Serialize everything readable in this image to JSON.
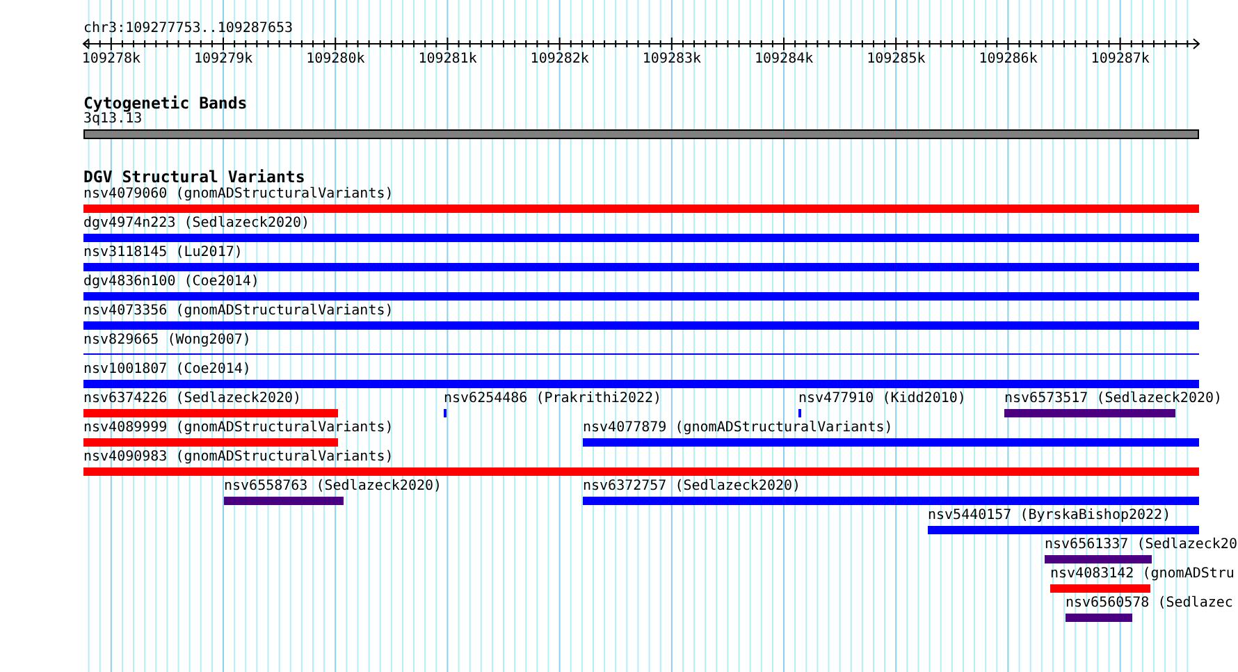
{
  "location": "chr3:109277753..109287653",
  "ruler": {
    "labels": [
      "109278k",
      "109279k",
      "109280k",
      "109281k",
      "109282k",
      "109283k",
      "109284k",
      "109285k",
      "109286k",
      "109287k"
    ]
  },
  "cytogenetic_bands": {
    "title": "Cytogenetic Bands",
    "band": "3q13.13"
  },
  "dgv_track": {
    "title": "DGV Structural Variants",
    "rows": [
      [
        {
          "label": "nsv4079060 (gnomADStructuralVariants)",
          "color": "#ff0000"
        }
      ],
      [
        {
          "label": "dgv4974n223 (Sedlazeck2020)",
          "color": "#0000ff"
        }
      ],
      [
        {
          "label": "nsv3118145 (Lu2017)",
          "color": "#0000ff"
        }
      ],
      [
        {
          "label": "dgv4836n100 (Coe2014)",
          "color": "#0000ff"
        }
      ],
      [
        {
          "label": "nsv4073356 (gnomADStructuralVariants)",
          "color": "#0000ff"
        }
      ],
      [
        {
          "label": "nsv829665 (Wong2007)",
          "color": "#0000ff"
        }
      ],
      [
        {
          "label": "nsv1001807 (Coe2014)",
          "color": "#0000ff"
        }
      ],
      [
        {
          "label": "nsv6374226 (Sedlazeck2020)",
          "color": "#ff0000"
        },
        {
          "label": "nsv6254486 (Prakrithi2022)",
          "color": "#0000ff"
        },
        {
          "label": "nsv477910 (Kidd2010)",
          "color": "#0000ff"
        },
        {
          "label": "nsv6573517 (Sedlazeck2020)",
          "color": "#4b0082"
        }
      ],
      [
        {
          "label": "nsv4089999 (gnomADStructuralVariants)",
          "color": "#ff0000"
        },
        {
          "label": "nsv4077879 (gnomADStructuralVariants)",
          "color": "#0000ff"
        }
      ],
      [
        {
          "label": "nsv4090983 (gnomADStructuralVariants)",
          "color": "#ff0000"
        }
      ],
      [
        {
          "label": "nsv6558763 (Sedlazeck2020)",
          "color": "#4b0082"
        },
        {
          "label": "nsv6372757 (Sedlazeck2020)",
          "color": "#0000ff"
        }
      ],
      [
        {
          "label": "nsv5440157 (ByrskaBishop2022)",
          "color": "#0000ff"
        }
      ],
      [
        {
          "label": "nsv6561337 (Sedlazeck20",
          "color": "#4b0082"
        }
      ],
      [
        {
          "label": "nsv4083142 (gnomADStru",
          "color": "#ff0000"
        }
      ],
      [
        {
          "label": "nsv6560578 (Sedlazec",
          "color": "#4b0082"
        }
      ]
    ]
  }
}
